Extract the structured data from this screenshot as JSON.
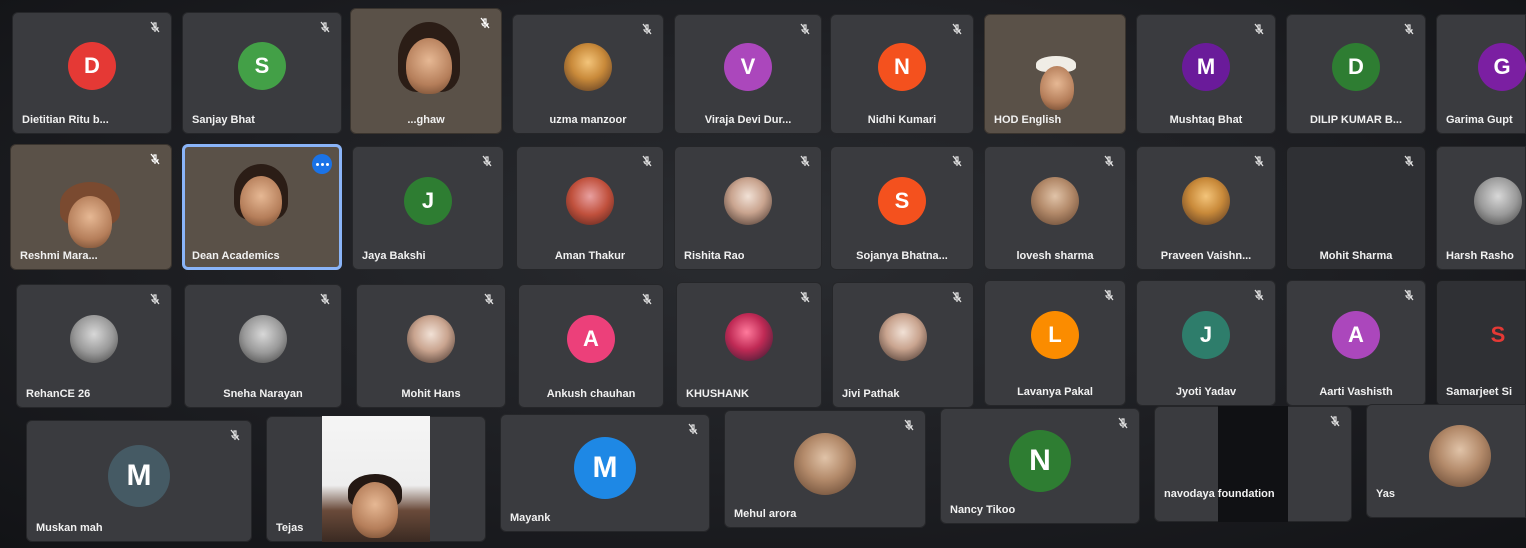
{
  "colors": {
    "tile": "#3a3b3f",
    "background": "#1c1d21",
    "active_border": "#8ab4f8"
  },
  "rows": [
    [
      {
        "name": "Dietitian Ritu b...",
        "type": "initial",
        "initial": "D",
        "color": "#e53935",
        "muted": true
      },
      {
        "name": "Sanjay Bhat",
        "type": "initial",
        "initial": "S",
        "color": "#43a047",
        "muted": true
      },
      {
        "name": "...ghaw",
        "type": "video",
        "muted": true
      },
      {
        "name": "uzma manzoor",
        "type": "photo",
        "muted": true
      },
      {
        "name": "Viraja Devi Dur...",
        "type": "initial",
        "initial": "V",
        "color": "#ab47bc",
        "muted": true
      },
      {
        "name": "Nidhi Kumari",
        "type": "initial",
        "initial": "N",
        "color": "#f4511e",
        "muted": true
      },
      {
        "name": "HOD English",
        "type": "video",
        "muted": false
      },
      {
        "name": "Mushtaq Bhat",
        "type": "initial",
        "initial": "M",
        "color": "#6a1b9a",
        "muted": true
      },
      {
        "name": "DILIP KUMAR B...",
        "type": "initial",
        "initial": "D",
        "color": "#2e7d32",
        "muted": true
      },
      {
        "name": "Garima Gupt",
        "type": "initial",
        "initial": "G",
        "color": "#7b1fa2",
        "muted": false
      }
    ],
    [
      {
        "name": "Reshmi Mara...",
        "type": "video",
        "muted": true
      },
      {
        "name": "Dean Academics",
        "type": "video",
        "muted": false,
        "active": true
      },
      {
        "name": "Jaya Bakshi",
        "type": "initial",
        "initial": "J",
        "color": "#2e7d32",
        "muted": true
      },
      {
        "name": "Aman Thakur",
        "type": "photo",
        "muted": true
      },
      {
        "name": "Rishita Rao",
        "type": "photo",
        "muted": true
      },
      {
        "name": "Sojanya Bhatna...",
        "type": "initial",
        "initial": "S",
        "color": "#f4511e",
        "muted": true
      },
      {
        "name": "lovesh sharma",
        "type": "photo",
        "muted": true
      },
      {
        "name": "Praveen Vaishn...",
        "type": "photo",
        "muted": true
      },
      {
        "name": "Mohit Sharma",
        "type": "blank",
        "muted": true
      },
      {
        "name": "Harsh Rasho",
        "type": "photo",
        "muted": false
      }
    ],
    [
      {
        "name": "RehanCE 26",
        "type": "photo",
        "muted": true
      },
      {
        "name": "Sneha Narayan",
        "type": "photo",
        "muted": true
      },
      {
        "name": "Mohit Hans",
        "type": "photo",
        "muted": true
      },
      {
        "name": "Ankush chauhan",
        "type": "initial",
        "initial": "A",
        "color": "#ec407a",
        "muted": true
      },
      {
        "name": "KHUSHANK",
        "type": "photo",
        "muted": true
      },
      {
        "name": "Jivi Pathak",
        "type": "photo",
        "muted": true
      },
      {
        "name": "Lavanya Pakal",
        "type": "initial",
        "initial": "L",
        "color": "#fb8c00",
        "muted": true
      },
      {
        "name": "Jyoti Yadav",
        "type": "initial",
        "initial": "J",
        "color": "#2e7d6b",
        "muted": true
      },
      {
        "name": "Aarti Vashisth",
        "type": "initial",
        "initial": "A",
        "color": "#ab47bc",
        "muted": true
      },
      {
        "name": "Samarjeet Si",
        "type": "initial",
        "initial": "S",
        "color": "#c62828",
        "muted": false
      }
    ],
    [
      {
        "name": "Muskan mah",
        "type": "initial",
        "initial": "M",
        "color": "#455a64",
        "muted": true
      },
      {
        "name": "Tejas",
        "type": "video",
        "muted": false
      },
      {
        "name": "Mayank",
        "type": "initial",
        "initial": "M",
        "color": "#1e88e5",
        "muted": true
      },
      {
        "name": "Mehul arora",
        "type": "photo",
        "muted": true
      },
      {
        "name": "Nancy Tikoo",
        "type": "initial",
        "initial": "N",
        "color": "#2e7d32",
        "muted": true
      },
      {
        "name": "navodaya foundation",
        "type": "dark",
        "muted": true
      },
      {
        "name": "Yas",
        "type": "photo",
        "muted": false
      }
    ]
  ]
}
